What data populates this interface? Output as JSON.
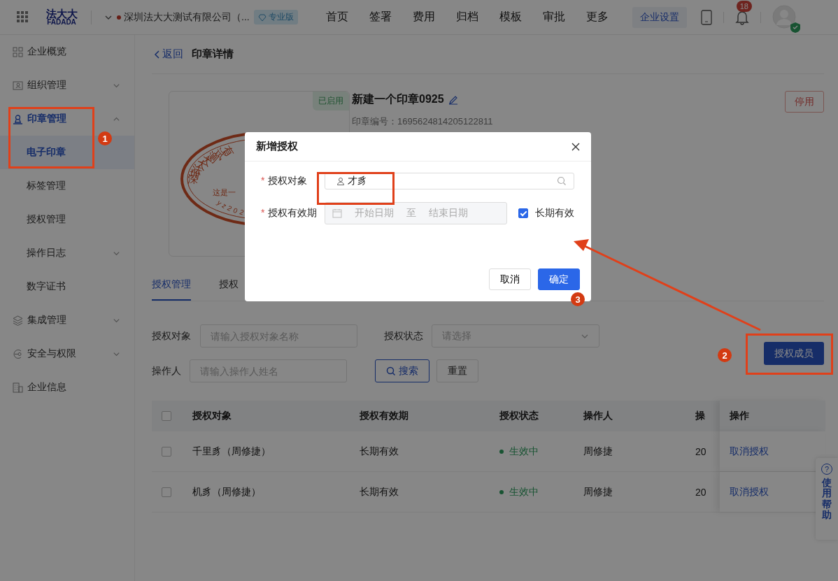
{
  "top_bar": {
    "logo_top": "法大大",
    "logo_bottom": "FADADA",
    "company": "深圳法大大测试有限公司（...",
    "edition": "专业版",
    "nav": [
      {
        "label": "首页"
      },
      {
        "label": "签署"
      },
      {
        "label": "费用"
      },
      {
        "label": "归档"
      },
      {
        "label": "模板"
      },
      {
        "label": "审批"
      },
      {
        "label": "更多"
      }
    ],
    "settings_button": "企业设置",
    "notification_count": "18"
  },
  "sidebar": {
    "items": [
      {
        "kind": "link",
        "label": "企业概览",
        "selected": false
      },
      {
        "kind": "group",
        "label": "组织管理",
        "selected": false,
        "expanded": false
      },
      {
        "kind": "group",
        "label": "印章管理",
        "selected": true,
        "expanded": true,
        "children": [
          {
            "kind": "link",
            "label": "电子印章",
            "selected": true
          },
          {
            "kind": "link",
            "label": "标签管理",
            "selected": false
          },
          {
            "kind": "link",
            "label": "授权管理",
            "selected": false
          },
          {
            "kind": "group",
            "label": "操作日志",
            "selected": false,
            "expanded": false
          },
          {
            "kind": "link",
            "label": "数字证书",
            "selected": false
          }
        ]
      },
      {
        "kind": "group",
        "label": "集成管理",
        "selected": false,
        "expanded": false
      },
      {
        "kind": "group",
        "label": "安全与权限",
        "selected": false,
        "expanded": false
      },
      {
        "kind": "link",
        "label": "企业信息",
        "selected": false
      }
    ]
  },
  "page_header": {
    "back_link": "返回",
    "title": "印章详情"
  },
  "seal": {
    "status_tag": "已启用",
    "arc_text": "深圳法大大测试有",
    "middle_text": "这是一",
    "bottom_text": "yz202",
    "name": "新建一个印章0925",
    "number": "印章编号：1695624814205122811",
    "disable_button": "停用"
  },
  "tabs": [
    {
      "label": "授权管理",
      "selected": true
    },
    {
      "label": "授权",
      "selected": false
    }
  ],
  "filters": {
    "object_label": "授权对象",
    "object_placeholder": "请输入授权对象名称",
    "status_label": "授权状态",
    "status_placeholder": "请选择",
    "operator_label": "操作人",
    "operator_placeholder": "请输入操作人姓名",
    "search_button": "搜索",
    "reset_button": "重置",
    "add_button": "授权成员"
  },
  "table": {
    "header_checked": false,
    "columns": [
      "授权对象",
      "授权有效期",
      "授权状态",
      "操作人",
      "操",
      "操作"
    ],
    "rows": [
      {
        "checked": false,
        "object": "千里豸（周修捷）",
        "period": "长期有效",
        "status": "生效中",
        "operator": "周修捷",
        "column_5": "20",
        "action": "取消授权"
      },
      {
        "checked": false,
        "object": "机豸（周修捷）",
        "period": "长期有效",
        "status": "生效中",
        "operator": "周修捷",
        "column_5": "20",
        "action": "取消授权"
      }
    ]
  },
  "help": {
    "icon": "?",
    "label": "使用帮助"
  },
  "modal": {
    "title": "新增授权",
    "required_mark": "*",
    "object_label": "授权对象",
    "object_required": true,
    "object_value": "才豸",
    "period_label": "授权有效期",
    "period_required": true,
    "start_placeholder": "开始日期",
    "separator": "至",
    "end_placeholder": "结束日期",
    "long_term_label": "长期有效",
    "long_term_checked": true,
    "cancel_button": "取消",
    "ok_button": "确定"
  },
  "annotations": {
    "badges": [
      "1",
      "2",
      "3"
    ]
  }
}
